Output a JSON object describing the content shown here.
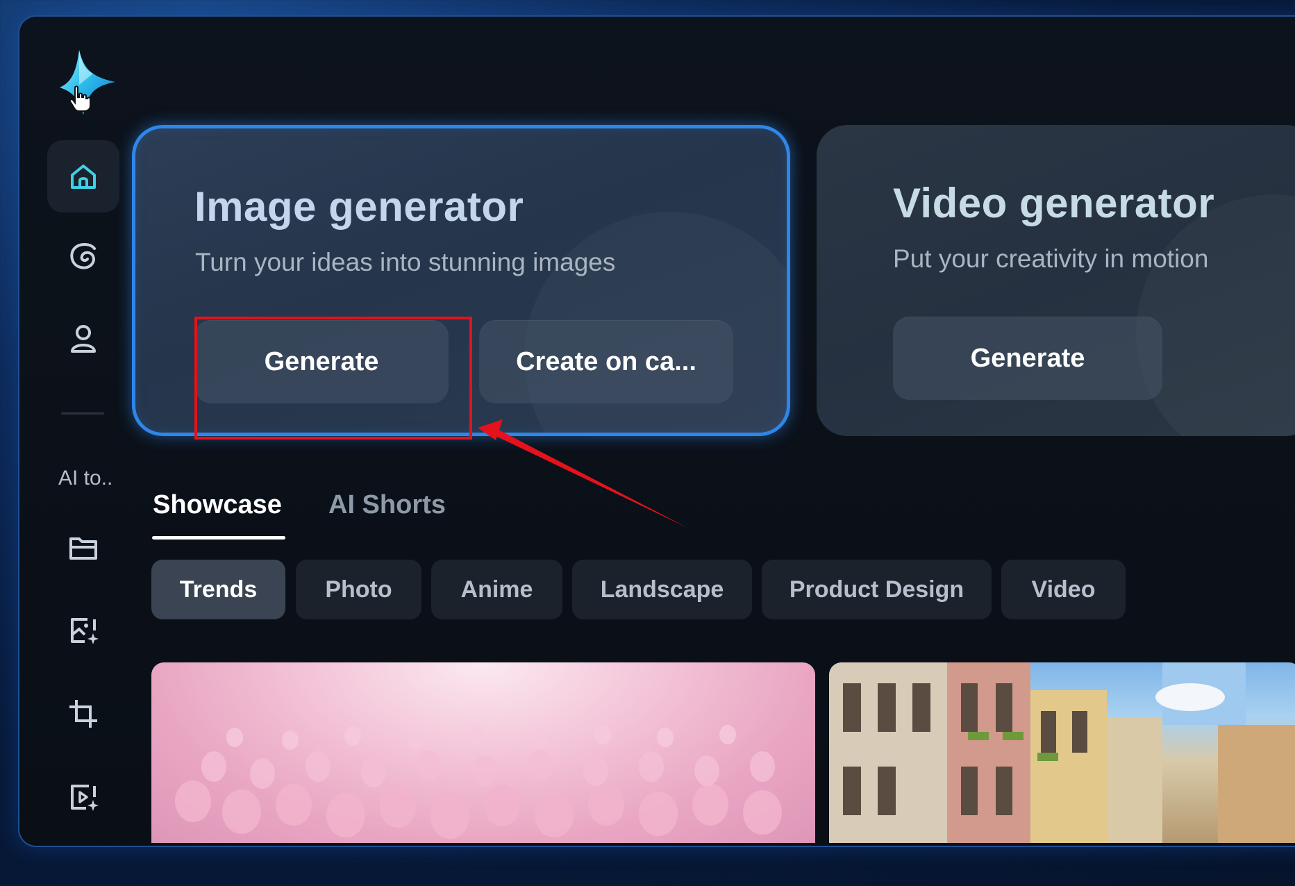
{
  "sidebar": {
    "logo_icon": "sparkle-logo-icon",
    "items": [
      {
        "icon": "home-icon",
        "active": true
      },
      {
        "icon": "swirl-icon",
        "active": false
      },
      {
        "icon": "user-icon",
        "active": false
      }
    ],
    "section_label": "AI to..",
    "tools": [
      {
        "icon": "folder-icon"
      },
      {
        "icon": "image-sparkle-icon"
      },
      {
        "icon": "crop-icon"
      },
      {
        "icon": "video-sparkle-icon"
      }
    ]
  },
  "cards": {
    "image": {
      "title": "Image generator",
      "subtitle": "Turn your ideas into stunning images",
      "primary_label": "Generate",
      "secondary_label": "Create on ca..."
    },
    "video": {
      "title": "Video generator",
      "subtitle": "Put your creativity in motion",
      "primary_label": "Generate"
    }
  },
  "tabs": [
    {
      "label": "Showcase",
      "active": true
    },
    {
      "label": "AI Shorts",
      "active": false
    }
  ],
  "chips": [
    {
      "label": "Trends",
      "active": true
    },
    {
      "label": "Photo",
      "active": false
    },
    {
      "label": "Anime",
      "active": false
    },
    {
      "label": "Landscape",
      "active": false
    },
    {
      "label": "Product Design",
      "active": false
    },
    {
      "label": "Video",
      "active": false
    }
  ],
  "thumbnails": [
    {
      "subject": "pink-spheres-field"
    },
    {
      "subject": "city-street-buildings"
    }
  ],
  "colors": {
    "accent_blue": "#2f86ea",
    "annotation_red": "#e5121b",
    "logo_cyan": "#29b8e8"
  }
}
